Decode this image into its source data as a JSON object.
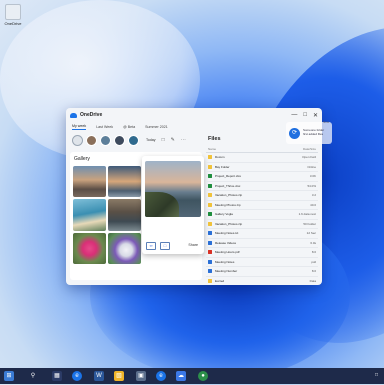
{
  "desktop": {
    "icon_label": "OneDrive"
  },
  "window": {
    "title": "OneDrive",
    "tabs": [
      "My week",
      "Last Week",
      "@ Beta",
      "Summer 2021"
    ],
    "toolbar_today": "Today",
    "gallery_title": "Gallery",
    "viewer_share": "Share",
    "files_title": "Files",
    "files_col_name": "Name",
    "files_col_size": "Date/Size",
    "files": [
      {
        "name": "Docum",
        "size": "Open Fwd",
        "color": "#f0c23a"
      },
      {
        "name": "Bay Folder",
        "size": "Online",
        "color": "#f0c23a"
      },
      {
        "name": "Project_Report.xlsx",
        "size": "3.0K",
        "color": "#1e8e3e"
      },
      {
        "name": "Project_Thrive.xlsx",
        "size": "54.0%",
        "color": "#1e8e3e"
      },
      {
        "name": "Vacation_Photos.zip",
        "size": "3.2",
        "color": "#f0c23a"
      },
      {
        "name": "Meeting Photos.zip",
        "size": "40.0",
        "color": "#f0c23a"
      },
      {
        "name": "Gallery Vogla",
        "size": "1.6 data next",
        "color": "#1e8e3e"
      },
      {
        "name": "Vacation_Photos.zip",
        "size": "50 Folder",
        "color": "#f0c23a"
      },
      {
        "name": "Meeting Notes.txt",
        "size": "12 Sec",
        "color": "#2a6fd6"
      },
      {
        "name": "Release Videos",
        "size": "6.0s",
        "color": "#2a6fd6"
      },
      {
        "name": "Meeting Hours.pdf",
        "size": "8.0",
        "color": "#d93025"
      },
      {
        "name": "Meeting Notes",
        "size": "poll",
        "color": "#2a6fd6"
      },
      {
        "name": "Meeting Number",
        "size": "8.0",
        "color": "#2a6fd6"
      },
      {
        "name": "Excted",
        "size": "Data",
        "color": "#f0c23a"
      },
      {
        "name": "Diem Notes",
        "size": "321 data",
        "color": "#2a6fd6"
      }
    ]
  },
  "notification": {
    "top_label": "Now",
    "line1": "Someone folder",
    "line2": "first added files"
  },
  "taskbar": {
    "start_icon": "windows-start-icon",
    "colors": {
      "bg": "#1e2a4a",
      "accent": "#1a73e8"
    }
  }
}
